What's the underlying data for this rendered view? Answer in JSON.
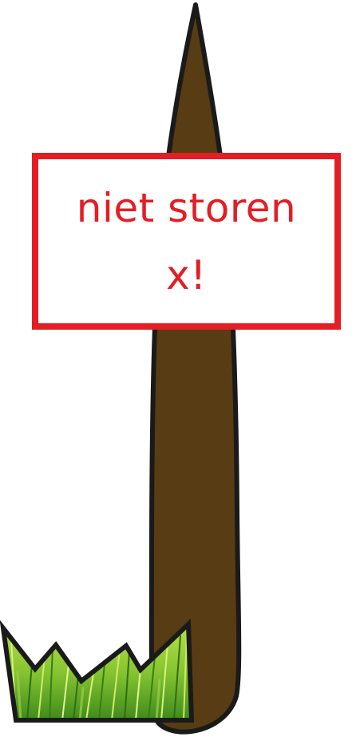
{
  "sign": {
    "line1": "niet storen",
    "line2": "x!"
  },
  "colors": {
    "sign_border": "#e31e24",
    "sign_text": "#e31e24",
    "sign_background": "#ffffff",
    "stick": "#573c14",
    "outline": "#1a1a1a",
    "grass_light": "#a8d63a",
    "grass_dark": "#3f8a1c"
  },
  "icons": {
    "stick": "wooden-stake-icon",
    "grass": "grass-tuft-icon"
  }
}
